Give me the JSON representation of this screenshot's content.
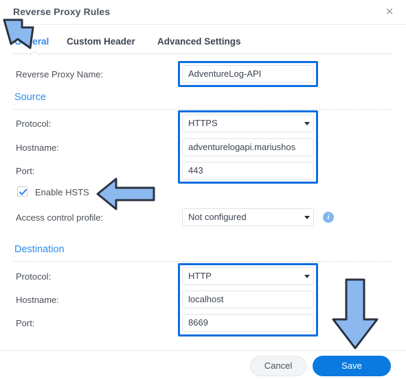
{
  "dialog": {
    "title": "Reverse Proxy Rules",
    "close_label": "✕"
  },
  "tabs": [
    {
      "label": "General",
      "active": true
    },
    {
      "label": "Custom Header",
      "active": false
    },
    {
      "label": "Advanced Settings",
      "active": false
    }
  ],
  "general": {
    "name_label": "Reverse Proxy Name:",
    "name_value": "AdventureLog-API"
  },
  "source": {
    "heading": "Source",
    "protocol_label": "Protocol:",
    "protocol_value": "HTTPS",
    "hostname_label": "Hostname:",
    "hostname_value": "adventurelogapi.mariushos",
    "port_label": "Port:",
    "port_value": "443",
    "hsts_label": "Enable HSTS",
    "hsts_checked": true,
    "acl_label": "Access control profile:",
    "acl_value": "Not configured",
    "info_glyph": "i"
  },
  "destination": {
    "heading": "Destination",
    "protocol_label": "Protocol:",
    "protocol_value": "HTTP",
    "hostname_label": "Hostname:",
    "hostname_value": "localhost",
    "port_label": "Port:",
    "port_value": "8669"
  },
  "footer": {
    "cancel_label": "Cancel",
    "save_label": "Save"
  },
  "colors": {
    "accent": "#2f8dec",
    "highlight": "#0b6fe0",
    "save_button": "#0b7ae0",
    "arrow_fill": "#8cb8f0",
    "arrow_stroke": "#2b3340"
  }
}
